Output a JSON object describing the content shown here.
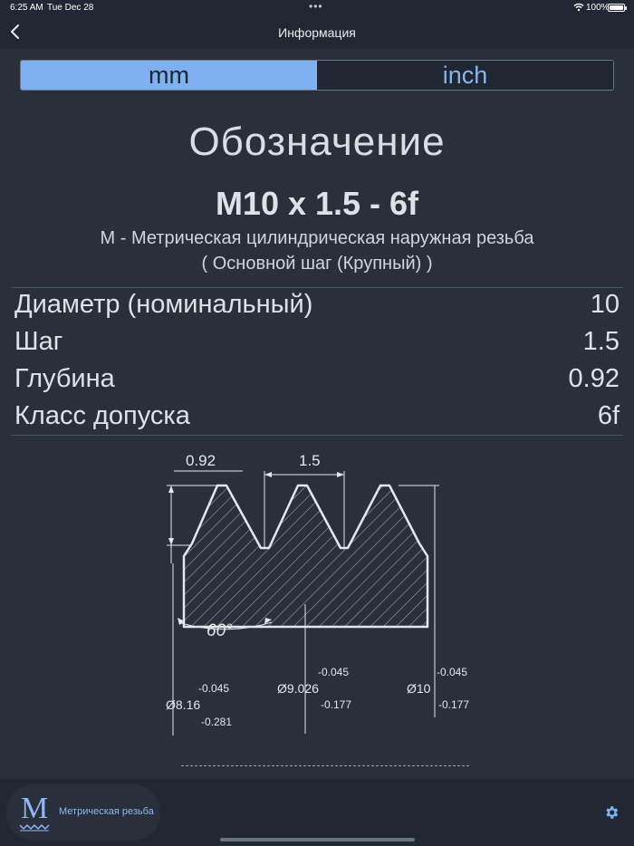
{
  "status": {
    "time": "6:25 AM",
    "date": "Tue Dec 28",
    "battery": "100%"
  },
  "nav": {
    "title": "Информация"
  },
  "units": {
    "options": [
      "mm",
      "inch"
    ],
    "selected": "mm"
  },
  "designation": {
    "title": "Обозначение",
    "code": "M10 x 1.5 - 6f",
    "description": "М - Метрическая цилиндрическая наружная резьба",
    "subtype": "( Основной шаг (Крупный) )"
  },
  "parameters": [
    {
      "label": "Диаметр (номинальный)",
      "value": "10"
    },
    {
      "label": "Шаг",
      "value": "1.5"
    },
    {
      "label": "Глубина",
      "value": "0.92"
    },
    {
      "label": "Класс допуска",
      "value": "6f"
    }
  ],
  "diagram": {
    "depth": "0.92",
    "pitch": "1.5",
    "angle": "60°",
    "minor": {
      "diameter": "Ø8.16",
      "upper": "-0.045",
      "lower": "-0.281"
    },
    "pitch_dia": {
      "diameter": "Ø9.026",
      "upper": "-0.045",
      "lower": "-0.177"
    },
    "major": {
      "diameter": "Ø10",
      "upper": "-0.045",
      "lower": "-0.177"
    }
  },
  "tab_bar": {
    "app_letter": "M",
    "app_name": "Метрическая резьба"
  },
  "colors": {
    "accent": "#7fb1f1",
    "background": "#222833",
    "panel": "#29303c"
  }
}
